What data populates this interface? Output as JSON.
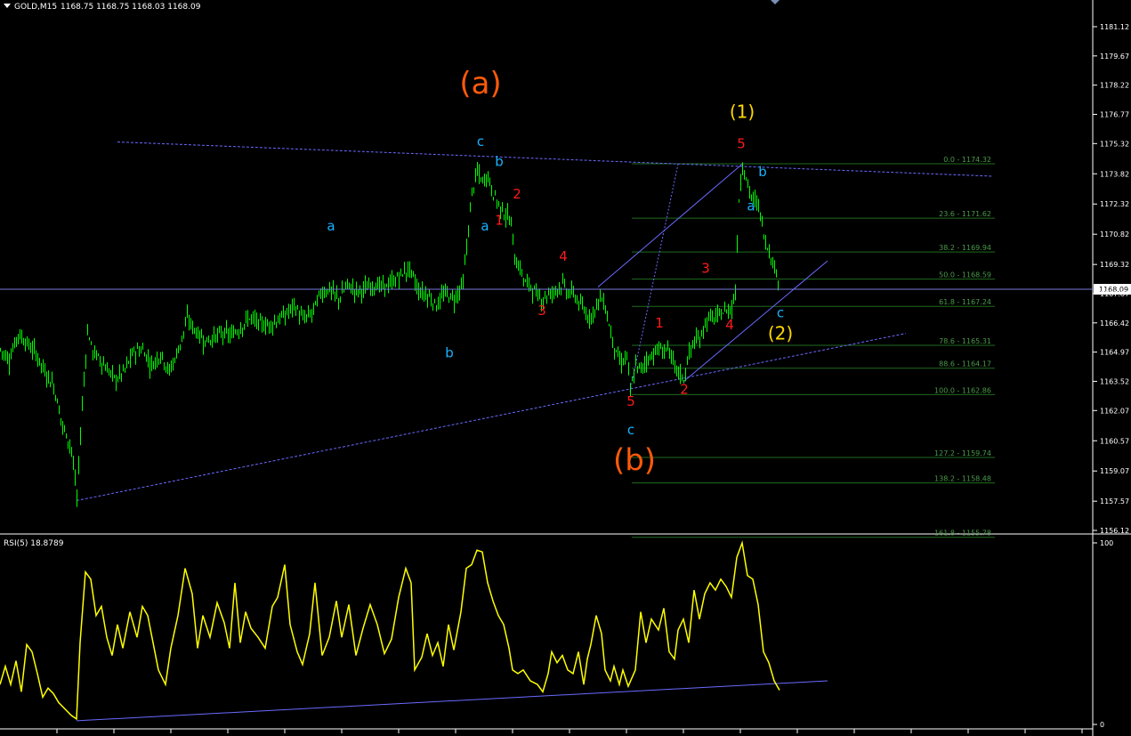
{
  "window": {
    "symbol_label": "GOLD,M15",
    "ohlc_label": "1168.75 1168.75 1168.03 1168.09"
  },
  "colors": {
    "background": "#000000",
    "candle": "#00ff00",
    "rsi_line": "#ffff00",
    "fib_line": "#1f6b1f",
    "fib_text": "#4a9a4a",
    "trend_line": "#6a6aff",
    "current_price_line": "#7a7adc",
    "axis": "#ffffff",
    "wave_red": "#ff1a1a",
    "wave_blue": "#1ab2ff",
    "wave_yellow": "#ffd700",
    "wave_orange": "#ff5a0a"
  },
  "chart_data": [
    {
      "type": "candlestick",
      "title": "GOLD,M15",
      "ylim": [
        1156.12,
        1182.5
      ],
      "price_ticks": [
        "1181.12",
        "1179.67",
        "1178.22",
        "1176.77",
        "1175.32",
        "1173.82",
        "1172.32",
        "1170.82",
        "1169.32",
        "1167.87",
        "1166.42",
        "1164.97",
        "1163.52",
        "1162.07",
        "1160.57",
        "1159.07",
        "1157.57",
        "1156.12"
      ],
      "current_price": "1168.09",
      "approx_close_path": [
        [
          0,
          1165.1
        ],
        [
          10,
          1164.6
        ],
        [
          20,
          1165.9
        ],
        [
          30,
          1165.4
        ],
        [
          40,
          1164.9
        ],
        [
          50,
          1164.0
        ],
        [
          60,
          1163.3
        ],
        [
          70,
          1161.3
        ],
        [
          80,
          1160.2
        ],
        [
          86,
          1157.7
        ],
        [
          92,
          1162.4
        ],
        [
          98,
          1166.0
        ],
        [
          104,
          1165.0
        ],
        [
          112,
          1164.6
        ],
        [
          120,
          1164.1
        ],
        [
          130,
          1163.6
        ],
        [
          140,
          1164.1
        ],
        [
          150,
          1165.0
        ],
        [
          160,
          1165.1
        ],
        [
          170,
          1164.3
        ],
        [
          180,
          1164.9
        ],
        [
          190,
          1164.0
        ],
        [
          200,
          1165.1
        ],
        [
          210,
          1166.6
        ],
        [
          220,
          1166.0
        ],
        [
          230,
          1165.5
        ],
        [
          240,
          1165.7
        ],
        [
          250,
          1165.9
        ],
        [
          260,
          1165.8
        ],
        [
          270,
          1166.2
        ],
        [
          280,
          1166.7
        ],
        [
          290,
          1166.4
        ],
        [
          300,
          1166.3
        ],
        [
          310,
          1166.5
        ],
        [
          320,
          1166.8
        ],
        [
          330,
          1167.3
        ],
        [
          340,
          1166.6
        ],
        [
          350,
          1166.9
        ],
        [
          360,
          1167.9
        ],
        [
          370,
          1168.1
        ],
        [
          380,
          1167.6
        ],
        [
          390,
          1168.3
        ],
        [
          400,
          1168.0
        ],
        [
          410,
          1168.1
        ],
        [
          420,
          1168.3
        ],
        [
          430,
          1168.2
        ],
        [
          440,
          1168.4
        ],
        [
          450,
          1168.8
        ],
        [
          460,
          1169.1
        ],
        [
          470,
          1168.0
        ],
        [
          480,
          1167.8
        ],
        [
          490,
          1167.3
        ],
        [
          500,
          1167.9
        ],
        [
          510,
          1167.6
        ],
        [
          520,
          1168.4
        ],
        [
          530,
          1172.9
        ],
        [
          536,
          1173.9
        ],
        [
          542,
          1173.4
        ],
        [
          548,
          1173.8
        ],
        [
          552,
          1173.0
        ],
        [
          558,
          1172.5
        ],
        [
          562,
          1172.1
        ],
        [
          568,
          1171.8
        ],
        [
          574,
          1171.4
        ],
        [
          578,
          1169.6
        ],
        [
          584,
          1169.1
        ],
        [
          590,
          1168.4
        ],
        [
          596,
          1168.3
        ],
        [
          602,
          1167.8
        ],
        [
          608,
          1167.6
        ],
        [
          614,
          1167.8
        ],
        [
          620,
          1167.9
        ],
        [
          626,
          1168.2
        ],
        [
          632,
          1168.3
        ],
        [
          638,
          1167.9
        ],
        [
          644,
          1167.9
        ],
        [
          650,
          1167.4
        ],
        [
          656,
          1167.0
        ],
        [
          662,
          1166.7
        ],
        [
          668,
          1167.1
        ],
        [
          674,
          1167.7
        ],
        [
          680,
          1167.2
        ],
        [
          686,
          1165.9
        ],
        [
          692,
          1164.9
        ],
        [
          698,
          1164.4
        ],
        [
          704,
          1164.8
        ],
        [
          708,
          1163.0
        ],
        [
          714,
          1164.3
        ],
        [
          720,
          1164.1
        ],
        [
          726,
          1164.6
        ],
        [
          732,
          1164.8
        ],
        [
          738,
          1165.1
        ],
        [
          744,
          1165.0
        ],
        [
          750,
          1165.2
        ],
        [
          756,
          1164.4
        ],
        [
          762,
          1164.0
        ],
        [
          768,
          1163.6
        ],
        [
          774,
          1164.9
        ],
        [
          780,
          1165.5
        ],
        [
          786,
          1165.6
        ],
        [
          792,
          1166.4
        ],
        [
          798,
          1166.7
        ],
        [
          804,
          1166.6
        ],
        [
          810,
          1166.9
        ],
        [
          816,
          1167.0
        ],
        [
          822,
          1167.2
        ],
        [
          826,
          1168.0
        ],
        [
          830,
          1172.6
        ],
        [
          834,
          1174.3
        ],
        [
          838,
          1173.6
        ],
        [
          842,
          1172.9
        ],
        [
          848,
          1172.4
        ],
        [
          852,
          1172.3
        ],
        [
          856,
          1171.3
        ],
        [
          860,
          1170.4
        ],
        [
          864,
          1170.0
        ],
        [
          868,
          1169.5
        ],
        [
          872,
          1168.8
        ],
        [
          876,
          1168.09
        ]
      ],
      "fib_levels": [
        {
          "label": "0.0 - 1174.32",
          "price": 1174.32
        },
        {
          "label": "23.6 - 1171.62",
          "price": 1171.62
        },
        {
          "label": "38.2 - 1169.94",
          "price": 1169.94
        },
        {
          "label": "50.0 - 1168.59",
          "price": 1168.59
        },
        {
          "label": "61.8 - 1167.24",
          "price": 1167.24
        },
        {
          "label": "78.6 - 1165.31",
          "price": 1165.31
        },
        {
          "label": "88.6 - 1164.17",
          "price": 1164.17
        },
        {
          "label": "100.0 - 1162.86",
          "price": 1162.86
        },
        {
          "label": "127.2 - 1159.74",
          "price": 1159.74
        },
        {
          "label": "138.2 - 1158.48",
          "price": 1158.48
        },
        {
          "label": "161.8 - 1155.78",
          "price": 1155.78
        }
      ],
      "wave_labels": [
        {
          "text": "(a)",
          "color": "orange",
          "size": "xl",
          "bar": 540,
          "price": 1177.8
        },
        {
          "text": "(b)",
          "color": "orange",
          "size": "xl",
          "bar": 713,
          "price": 1159.1
        },
        {
          "text": "(1)",
          "color": "yellow",
          "size": "l",
          "bar": 834,
          "price": 1176.6
        },
        {
          "text": "(2)",
          "color": "yellow",
          "size": "l",
          "bar": 877,
          "price": 1165.6
        },
        {
          "text": "c",
          "color": "blue",
          "bar": 540,
          "price": 1175.2
        },
        {
          "text": "b",
          "color": "blue",
          "bar": 561,
          "price": 1174.2
        },
        {
          "text": "a",
          "color": "blue",
          "bar": 545,
          "price": 1171.0
        },
        {
          "text": "a",
          "color": "blue",
          "bar": 372,
          "price": 1171.0
        },
        {
          "text": "b",
          "color": "blue",
          "bar": 505,
          "price": 1164.7
        },
        {
          "text": "c",
          "color": "blue",
          "bar": 709,
          "price": 1160.9
        },
        {
          "text": "b",
          "color": "blue",
          "bar": 857,
          "price": 1173.7
        },
        {
          "text": "a",
          "color": "blue",
          "bar": 844,
          "price": 1172.0
        },
        {
          "text": "c",
          "color": "blue",
          "bar": 877,
          "price": 1166.7
        },
        {
          "text": "1",
          "color": "red",
          "bar": 561,
          "price": 1171.3
        },
        {
          "text": "2",
          "color": "red",
          "bar": 581,
          "price": 1172.6
        },
        {
          "text": "3",
          "color": "red",
          "bar": 609,
          "price": 1166.8
        },
        {
          "text": "4",
          "color": "red",
          "bar": 633,
          "price": 1169.5
        },
        {
          "text": "5",
          "color": "red",
          "bar": 709,
          "price": 1162.3
        },
        {
          "text": "1",
          "color": "red",
          "bar": 741,
          "price": 1166.2
        },
        {
          "text": "2",
          "color": "red",
          "bar": 769,
          "price": 1162.9
        },
        {
          "text": "3",
          "color": "red",
          "bar": 793,
          "price": 1168.9
        },
        {
          "text": "4",
          "color": "red",
          "bar": 820,
          "price": 1166.1
        },
        {
          "text": "5",
          "color": "red",
          "bar": 833,
          "price": 1175.1
        }
      ]
    },
    {
      "type": "line",
      "title": "RSI(5) 18.8789",
      "series": [
        {
          "name": "RSI(5)",
          "color": "yellow"
        }
      ],
      "ylim": [
        0,
        100
      ],
      "ticks": [
        "100",
        "0"
      ],
      "current": 18.8789,
      "values": [
        [
          0,
          22
        ],
        [
          6,
          32
        ],
        [
          12,
          22
        ],
        [
          18,
          35
        ],
        [
          24,
          18
        ],
        [
          30,
          44
        ],
        [
          36,
          40
        ],
        [
          42,
          28
        ],
        [
          48,
          15
        ],
        [
          54,
          20
        ],
        [
          60,
          17
        ],
        [
          66,
          12
        ],
        [
          72,
          9
        ],
        [
          80,
          5
        ],
        [
          86,
          3
        ],
        [
          90,
          45
        ],
        [
          96,
          84
        ],
        [
          102,
          80
        ],
        [
          108,
          60
        ],
        [
          114,
          65
        ],
        [
          120,
          48
        ],
        [
          126,
          38
        ],
        [
          132,
          55
        ],
        [
          138,
          42
        ],
        [
          146,
          62
        ],
        [
          154,
          48
        ],
        [
          160,
          65
        ],
        [
          166,
          60
        ],
        [
          172,
          45
        ],
        [
          178,
          30
        ],
        [
          186,
          22
        ],
        [
          192,
          42
        ],
        [
          200,
          60
        ],
        [
          208,
          86
        ],
        [
          216,
          72
        ],
        [
          222,
          42
        ],
        [
          228,
          60
        ],
        [
          236,
          48
        ],
        [
          244,
          67
        ],
        [
          252,
          56
        ],
        [
          258,
          42
        ],
        [
          264,
          78
        ],
        [
          270,
          45
        ],
        [
          276,
          62
        ],
        [
          282,
          53
        ],
        [
          290,
          48
        ],
        [
          298,
          42
        ],
        [
          306,
          65
        ],
        [
          312,
          70
        ],
        [
          320,
          88
        ],
        [
          326,
          55
        ],
        [
          334,
          40
        ],
        [
          340,
          33
        ],
        [
          348,
          50
        ],
        [
          354,
          78
        ],
        [
          362,
          38
        ],
        [
          370,
          48
        ],
        [
          378,
          68
        ],
        [
          384,
          48
        ],
        [
          392,
          66
        ],
        [
          400,
          38
        ],
        [
          408,
          53
        ],
        [
          416,
          66
        ],
        [
          424,
          55
        ],
        [
          432,
          39
        ],
        [
          440,
          47
        ],
        [
          448,
          70
        ],
        [
          456,
          86
        ],
        [
          462,
          78
        ],
        [
          466,
          30
        ],
        [
          474,
          37
        ],
        [
          480,
          50
        ],
        [
          486,
          38
        ],
        [
          492,
          45
        ],
        [
          498,
          32
        ],
        [
          504,
          55
        ],
        [
          510,
          41
        ],
        [
          518,
          62
        ],
        [
          524,
          86
        ],
        [
          530,
          88
        ],
        [
          536,
          96
        ],
        [
          542,
          95
        ],
        [
          548,
          78
        ],
        [
          554,
          68
        ],
        [
          560,
          60
        ],
        [
          566,
          55
        ],
        [
          572,
          42
        ],
        [
          576,
          30
        ],
        [
          582,
          28
        ],
        [
          588,
          30
        ],
        [
          596,
          24
        ],
        [
          604,
          22
        ],
        [
          610,
          18
        ],
        [
          616,
          28
        ],
        [
          620,
          40
        ],
        [
          626,
          34
        ],
        [
          632,
          38
        ],
        [
          638,
          30
        ],
        [
          644,
          28
        ],
        [
          650,
          40
        ],
        [
          656,
          22
        ],
        [
          660,
          36
        ],
        [
          664,
          44
        ],
        [
          670,
          60
        ],
        [
          676,
          50
        ],
        [
          680,
          30
        ],
        [
          686,
          24
        ],
        [
          690,
          32
        ],
        [
          696,
          22
        ],
        [
          700,
          30
        ],
        [
          706,
          21
        ],
        [
          714,
          30
        ],
        [
          720,
          62
        ],
        [
          726,
          45
        ],
        [
          732,
          58
        ],
        [
          740,
          52
        ],
        [
          746,
          64
        ],
        [
          752,
          40
        ],
        [
          758,
          36
        ],
        [
          762,
          52
        ],
        [
          768,
          58
        ],
        [
          774,
          45
        ],
        [
          780,
          74
        ],
        [
          786,
          58
        ],
        [
          792,
          72
        ],
        [
          798,
          78
        ],
        [
          804,
          74
        ],
        [
          810,
          80
        ],
        [
          816,
          76
        ],
        [
          822,
          70
        ],
        [
          828,
          92
        ],
        [
          834,
          100
        ],
        [
          840,
          82
        ],
        [
          846,
          80
        ],
        [
          852,
          66
        ],
        [
          858,
          40
        ],
        [
          864,
          34
        ],
        [
          870,
          24
        ],
        [
          876,
          18.9
        ]
      ]
    }
  ]
}
